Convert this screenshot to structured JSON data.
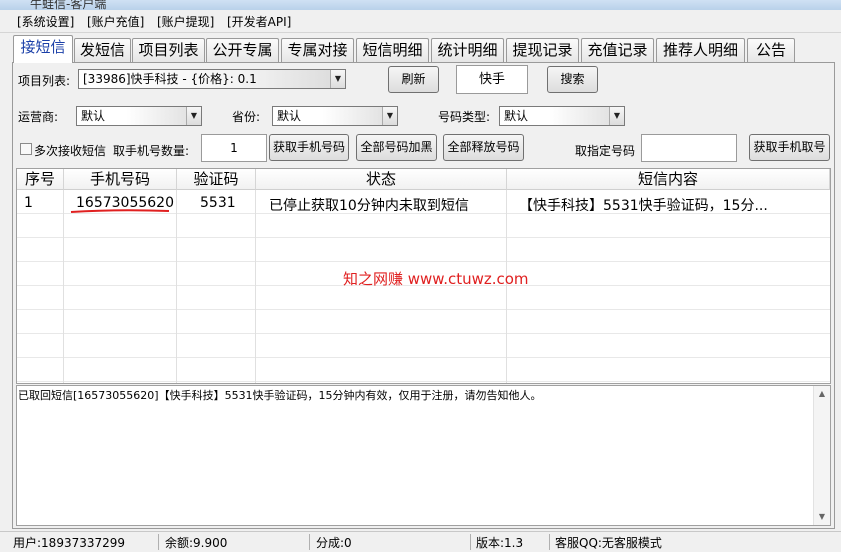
{
  "window": {
    "title": "牛蛙信-客户端"
  },
  "menu": [
    "[系统设置]",
    "[账户充值]",
    "[账户提现]",
    "[开发者API]"
  ],
  "tabs": [
    {
      "label": "接短信",
      "active": true
    },
    {
      "label": "发短信"
    },
    {
      "label": "项目列表"
    },
    {
      "label": "公开专属"
    },
    {
      "label": "专属对接"
    },
    {
      "label": "短信明细"
    },
    {
      "label": "统计明细"
    },
    {
      "label": "提现记录"
    },
    {
      "label": "充值记录"
    },
    {
      "label": "推荐人明细"
    },
    {
      "label": "公告"
    }
  ],
  "project": {
    "label": "项目列表:",
    "value": "[33986]快手科技 - {价格}: 0.1",
    "refresh": "刷新",
    "search_value": "快手",
    "search_button": "搜索"
  },
  "filters": {
    "operator_label": "运营商:",
    "operator_value": "默认",
    "province_label": "省份:",
    "province_value": "默认",
    "numtype_label": "号码类型:",
    "numtype_value": "默认"
  },
  "actions": {
    "multi_receive": "多次接收短信",
    "count_label": "取手机号数量:",
    "count_value": "1",
    "get_phone": "获取手机号码",
    "blacklist_all": "全部号码加黑",
    "release_all": "全部释放号码",
    "specify_label": "取指定号码",
    "specify_value": "",
    "get_phone_specific": "获取手机取号"
  },
  "table": {
    "columns": [
      "序号",
      "手机号码",
      "验证码",
      "状态",
      "短信内容"
    ],
    "rows": [
      [
        "1",
        "16573055620",
        "5531",
        "已停止获取10分钟内未取到短信",
        "【快手科技】5531快手验证码，15分..."
      ]
    ]
  },
  "watermark": "知之网赚 www.ctuwz.com",
  "log": "已取回短信[16573055620]【快手科技】5531快手验证码，15分钟内有效，仅用于注册，请勿告知他人。",
  "status": {
    "user": "用户:18937337299",
    "balance": "余额:9.900",
    "points": "分成:0",
    "version": "版本:1.3",
    "qq": "客服QQ:无客服模式"
  },
  "colors": {
    "active_tab_text": "#1a3fa8",
    "watermark": "#e02020",
    "underline": "#e02020"
  }
}
